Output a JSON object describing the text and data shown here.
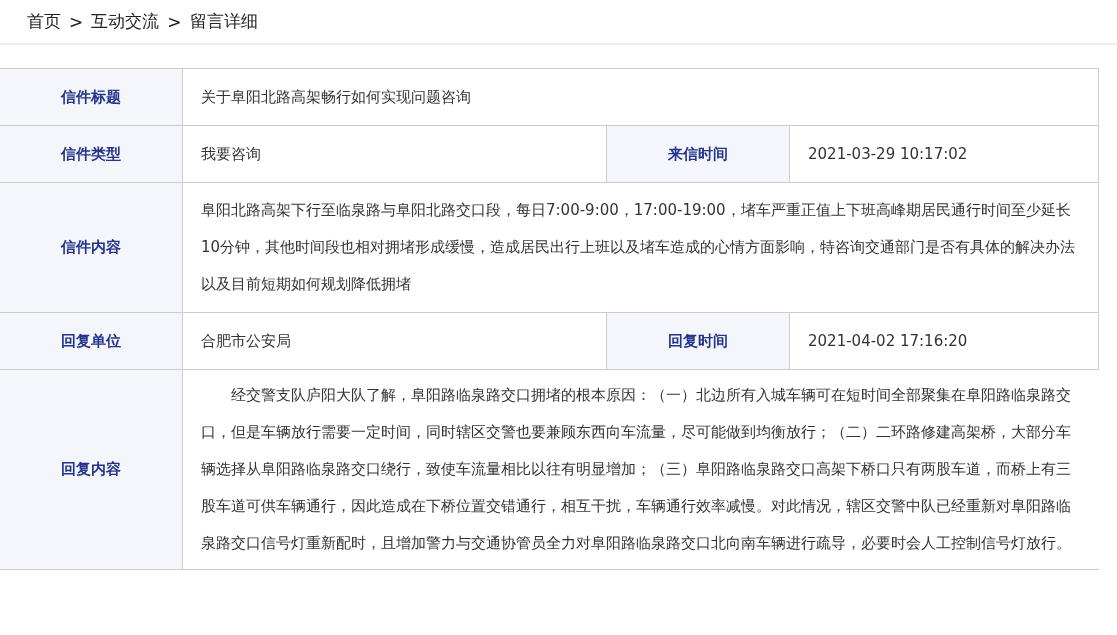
{
  "breadcrumb": {
    "separator": ">",
    "items": [
      {
        "label": "首页"
      },
      {
        "label": "互动交流"
      },
      {
        "label": "留言详细"
      }
    ]
  },
  "detail_table": {
    "rows": [
      {
        "kind": "single",
        "label": "信件标题",
        "value": "关于阜阳北路高架畅行如何实现问题咨询"
      },
      {
        "kind": "pair",
        "label": "信件类型",
        "value": "我要咨询",
        "label_2": "来信时间",
        "value_2": "2021-03-29 10:17:02"
      },
      {
        "kind": "text",
        "label": "信件内容",
        "value": "阜阳北路高架下行至临泉路与阜阳北路交口段，每日7:00-9:00，17:00-19:00，堵车严重正值上下班高峰期居民通行时间至少延长10分钟，其他时间段也相对拥堵形成缓慢，造成居民出行上班以及堵车造成的心情方面影响，特咨询交通部门是否有具体的解决办法以及目前短期如何规划降低拥堵"
      },
      {
        "kind": "pair",
        "label": "回复单位",
        "value": "合肥市公安局",
        "label_2": "回复时间",
        "value_2": "2021-04-02 17:16:20"
      },
      {
        "kind": "indented",
        "label": "回复内容",
        "value": "经交警支队庐阳大队了解，阜阳路临泉路交口拥堵的根本原因：（一）北边所有入城车辆可在短时间全部聚集在阜阳路临泉路交口，但是车辆放行需要一定时间，同时辖区交警也要兼顾东西向车流量，尽可能做到均衡放行；（二）二环路修建高架桥，大部分车辆选择从阜阳路临泉路交口绕行，致使车流量相比以往有明显增加；（三）阜阳路临泉路交口高架下桥口只有两股车道，而桥上有三股车道可供车辆通行，因此造成在下桥位置交错通行，相互干扰，车辆通行效率减慢。对此情况，辖区交警中队已经重新对阜阳路临泉路交口信号灯重新配时，且增加警力与交通协管员全力对阜阳路临泉路交口北向南车辆进行疏导，必要时会人工控制信号灯放行。"
      }
    ]
  }
}
